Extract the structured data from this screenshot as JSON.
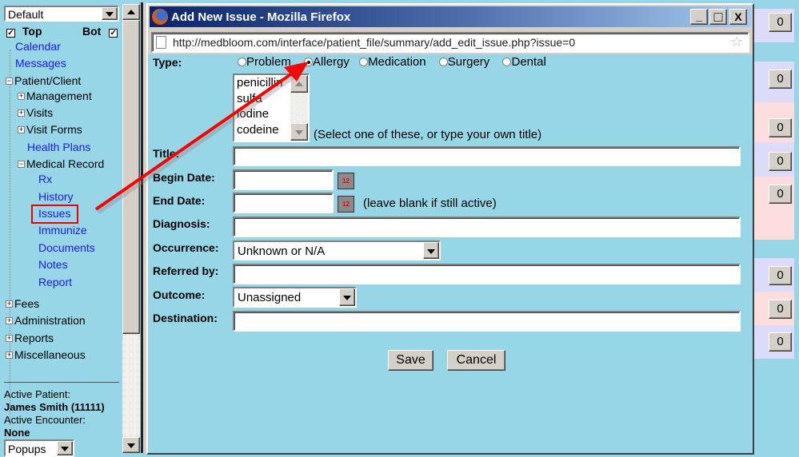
{
  "sidebar": {
    "frame_select": "Default",
    "top_label": "Top",
    "bot_label": "Bot",
    "top_checked": true,
    "bot_checked": true,
    "items": {
      "calendar": "Calendar",
      "messages": "Messages",
      "patient_client": "Patient/Client",
      "management": "Management",
      "visits": "Visits",
      "visit_forms": "Visit Forms",
      "health_plans": "Health Plans",
      "medical_record": "Medical Record",
      "rx": "Rx",
      "history": "History",
      "issues": "Issues",
      "immunize": "Immunize",
      "documents": "Documents",
      "notes": "Notes",
      "report": "Report",
      "fees": "Fees",
      "administration": "Administration",
      "reports": "Reports",
      "miscellaneous": "Miscellaneous"
    },
    "active_patient_label": "Active Patient:",
    "active_patient": "James Smith (11111)",
    "active_encounter_label": "Active Encounter:",
    "active_encounter": "None",
    "popups_select": "Popups"
  },
  "window": {
    "title": "Add New Issue - Mozilla Firefox",
    "url": "http://medbloom.com/interface/patient_file/summary/add_edit_issue.php?issue=0",
    "minimize": "_",
    "maximize": "□",
    "close": "X"
  },
  "form": {
    "type_label": "Type:",
    "types": [
      "Problem",
      "Allergy",
      "Medication",
      "Surgery",
      "Dental"
    ],
    "selected_type": "Allergy",
    "title_options": [
      "penicillin",
      "sulfa",
      "iodine",
      "codeine"
    ],
    "title_hint": "(Select one of these, or type your own title)",
    "title_label": "Title:",
    "title_value": "",
    "begin_date_label": "Begin Date:",
    "begin_date_value": "",
    "end_date_label": "End Date:",
    "end_date_value": "",
    "end_date_hint": "(leave blank if still active)",
    "diagnosis_label": "Diagnosis:",
    "diagnosis_value": "",
    "occurrence_label": "Occurrence:",
    "occurrence_value": "Unknown or N/A",
    "referred_by_label": "Referred by:",
    "referred_by_value": "",
    "outcome_label": "Outcome:",
    "outcome_value": "Unassigned",
    "destination_label": "Destination:",
    "destination_value": "",
    "save": "Save",
    "cancel": "Cancel"
  },
  "background_counts": [
    "0",
    "0",
    "0",
    "0",
    "0",
    "0",
    "0",
    "0"
  ],
  "colors": {
    "page_bg": "#96d6e6",
    "annotation": "#ff0000",
    "row_lavender": "#dcdcfa",
    "row_pink": "#fcdcdc",
    "link": "#1a1ae6"
  }
}
